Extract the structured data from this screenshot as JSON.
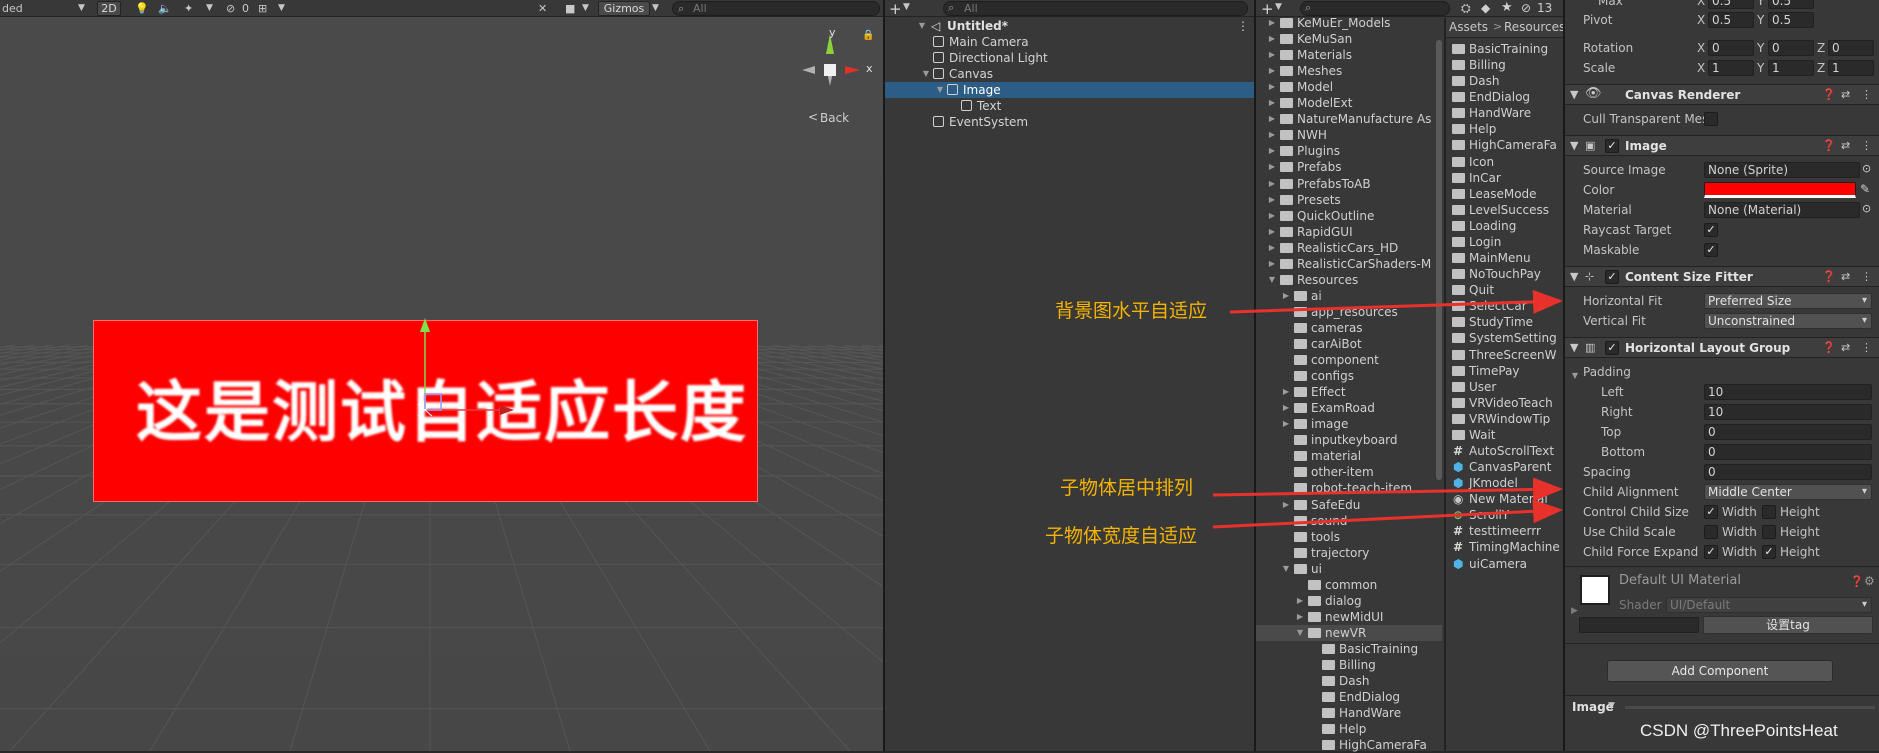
{
  "scene": {
    "toolbar": {
      "shading_mode": "ded",
      "mode_2d": "2D",
      "hidden_count": "0",
      "gizmos": "Gizmos",
      "search_placeholder": "All"
    },
    "gizmo": {
      "y": "y",
      "x": "x",
      "back": "Back"
    },
    "canvas_text": "这是测试自适应长度"
  },
  "hierarchy": {
    "search_placeholder": "All",
    "scene_name": "Untitled*",
    "items": [
      {
        "label": "Main Camera",
        "level": 1
      },
      {
        "label": "Directional Light",
        "level": 1
      },
      {
        "label": "Canvas",
        "level": 1
      },
      {
        "label": "Image",
        "level": 2
      },
      {
        "label": "Text",
        "level": 3
      },
      {
        "label": "EventSystem",
        "level": 1
      }
    ]
  },
  "project": {
    "search_placeholder": "",
    "hidden_count": "13",
    "folders": [
      {
        "label": "KeMuEr_Models",
        "level": 0,
        "arrow": "right"
      },
      {
        "label": "KeMuSan",
        "level": 0,
        "arrow": "right"
      },
      {
        "label": "Materials",
        "level": 0,
        "arrow": "right"
      },
      {
        "label": "Meshes",
        "level": 0,
        "arrow": "right"
      },
      {
        "label": "Model",
        "level": 0,
        "arrow": "right"
      },
      {
        "label": "ModelExt",
        "level": 0,
        "arrow": "right"
      },
      {
        "label": "NatureManufacture As",
        "level": 0,
        "arrow": "right"
      },
      {
        "label": "NWH",
        "level": 0,
        "arrow": "right"
      },
      {
        "label": "Plugins",
        "level": 0,
        "arrow": "right"
      },
      {
        "label": "Prefabs",
        "level": 0,
        "arrow": "right"
      },
      {
        "label": "PrefabsToAB",
        "level": 0,
        "arrow": "right"
      },
      {
        "label": "Presets",
        "level": 0,
        "arrow": "right"
      },
      {
        "label": "QuickOutline",
        "level": 0,
        "arrow": "right"
      },
      {
        "label": "RapidGUI",
        "level": 0,
        "arrow": "right"
      },
      {
        "label": "RealisticCars_HD",
        "level": 0,
        "arrow": "right"
      },
      {
        "label": "RealisticCarShaders-M",
        "level": 0,
        "arrow": "right"
      },
      {
        "label": "Resources",
        "level": 0,
        "arrow": "down"
      },
      {
        "label": "ai",
        "level": 1,
        "arrow": "right"
      },
      {
        "label": "app_resources",
        "level": 1,
        "arrow": ""
      },
      {
        "label": "cameras",
        "level": 1,
        "arrow": ""
      },
      {
        "label": "carAiBot",
        "level": 1,
        "arrow": ""
      },
      {
        "label": "component",
        "level": 1,
        "arrow": ""
      },
      {
        "label": "configs",
        "level": 1,
        "arrow": ""
      },
      {
        "label": "Effect",
        "level": 1,
        "arrow": "right"
      },
      {
        "label": "ExamRoad",
        "level": 1,
        "arrow": "right"
      },
      {
        "label": "image",
        "level": 1,
        "arrow": "right"
      },
      {
        "label": "inputkeyboard",
        "level": 1,
        "arrow": ""
      },
      {
        "label": "material",
        "level": 1,
        "arrow": ""
      },
      {
        "label": "other-item",
        "level": 1,
        "arrow": ""
      },
      {
        "label": "robot-teach-item",
        "level": 1,
        "arrow": ""
      },
      {
        "label": "SafeEdu",
        "level": 1,
        "arrow": "right"
      },
      {
        "label": "sound",
        "level": 1,
        "arrow": ""
      },
      {
        "label": "tools",
        "level": 1,
        "arrow": ""
      },
      {
        "label": "trajectory",
        "level": 1,
        "arrow": ""
      },
      {
        "label": "ui",
        "level": 1,
        "arrow": "down"
      },
      {
        "label": "common",
        "level": 2,
        "arrow": ""
      },
      {
        "label": "dialog",
        "level": 2,
        "arrow": "right"
      },
      {
        "label": "newMidUI",
        "level": 2,
        "arrow": "right"
      },
      {
        "label": "newVR",
        "level": 2,
        "arrow": "down"
      },
      {
        "label": "BasicTraining",
        "level": 3,
        "arrow": ""
      },
      {
        "label": "Billing",
        "level": 3,
        "arrow": ""
      },
      {
        "label": "Dash",
        "level": 3,
        "arrow": ""
      },
      {
        "label": "EndDialog",
        "level": 3,
        "arrow": ""
      },
      {
        "label": "HandWare",
        "level": 3,
        "arrow": ""
      },
      {
        "label": "Help",
        "level": 3,
        "arrow": ""
      },
      {
        "label": "HighCameraFa",
        "level": 3,
        "arrow": ""
      }
    ],
    "breadcrumb": [
      "Assets",
      "Resources"
    ],
    "files": [
      {
        "label": "BasicTraining",
        "kind": "folder"
      },
      {
        "label": "Billing",
        "kind": "folder"
      },
      {
        "label": "Dash",
        "kind": "folder"
      },
      {
        "label": "EndDialog",
        "kind": "folder"
      },
      {
        "label": "HandWare",
        "kind": "folder"
      },
      {
        "label": "Help",
        "kind": "folder"
      },
      {
        "label": "HighCameraFa",
        "kind": "folder"
      },
      {
        "label": "Icon",
        "kind": "folder"
      },
      {
        "label": "InCar",
        "kind": "folder"
      },
      {
        "label": "LeaseMode",
        "kind": "folder"
      },
      {
        "label": "LevelSuccess",
        "kind": "folder"
      },
      {
        "label": "Loading",
        "kind": "folder"
      },
      {
        "label": "Login",
        "kind": "folder"
      },
      {
        "label": "MainMenu",
        "kind": "folder"
      },
      {
        "label": "NoTouchPay",
        "kind": "folder"
      },
      {
        "label": "Quit",
        "kind": "folder"
      },
      {
        "label": "SelectCar",
        "kind": "folder"
      },
      {
        "label": "StudyTime",
        "kind": "folder"
      },
      {
        "label": "SystemSetting",
        "kind": "folder"
      },
      {
        "label": "ThreeScreenW",
        "kind": "folder"
      },
      {
        "label": "TimePay",
        "kind": "folder"
      },
      {
        "label": "User",
        "kind": "folder"
      },
      {
        "label": "VRVideoTeach",
        "kind": "folder"
      },
      {
        "label": "VRWindowTip",
        "kind": "folder"
      },
      {
        "label": "Wait",
        "kind": "folder"
      },
      {
        "label": "AutoScrollText",
        "kind": "script"
      },
      {
        "label": "CanvasParent",
        "kind": "prefab"
      },
      {
        "label": "JKmodel",
        "kind": "prefab"
      },
      {
        "label": "New Material",
        "kind": "material"
      },
      {
        "label": "ScrollY",
        "kind": "asset"
      },
      {
        "label": "testtimeerrr",
        "kind": "script"
      },
      {
        "label": "TimingMachine",
        "kind": "script"
      },
      {
        "label": "uiCamera",
        "kind": "prefab"
      }
    ]
  },
  "inspector": {
    "top": {
      "max_label": "Max",
      "max_x": "0.5",
      "max_y": "0.5",
      "pivot_label": "Pivot",
      "pivot_x": "0.5",
      "pivot_y": "0.5",
      "rotation_label": "Rotation",
      "rot_x": "0",
      "rot_y": "0",
      "rot_z": "0",
      "scale_label": "Scale",
      "scale_x": "1",
      "scale_y": "1",
      "scale_z": "1",
      "x": "X",
      "y": "Y",
      "z": "Z"
    },
    "canvas_renderer": {
      "title": "Canvas Renderer",
      "cull_label": "Cull Transparent Mes"
    },
    "image": {
      "title": "Image",
      "source_label": "Source Image",
      "source_value": "None (Sprite)",
      "color_label": "Color",
      "color_value": "#ff0000",
      "material_label": "Material",
      "material_value": "None (Material)",
      "raycast_label": "Raycast Target",
      "maskable_label": "Maskable"
    },
    "csf": {
      "title": "Content Size Fitter",
      "h_label": "Horizontal Fit",
      "h_value": "Preferred Size",
      "v_label": "Vertical Fit",
      "v_value": "Unconstrained"
    },
    "hlg": {
      "title": "Horizontal Layout Group",
      "padding_label": "Padding",
      "left_label": "Left",
      "left": "10",
      "right_label": "Right",
      "right": "10",
      "top_label": "Top",
      "top": "0",
      "bottom_label": "Bottom",
      "bottom": "0",
      "spacing_label": "Spacing",
      "spacing": "0",
      "align_label": "Child Alignment",
      "align_value": "Middle Center",
      "ccs_label": "Control Child Size",
      "ucs_label": "Use Child Scale",
      "cfe_label": "Child Force Expand",
      "width": "Width",
      "height": "Height"
    },
    "material": {
      "title": "Default UI Material",
      "shader_label": "Shader",
      "shader_value": "UI/Default",
      "tag_button": "设置tag"
    },
    "add_component": "Add Component",
    "footer": "Image"
  },
  "annotations": {
    "bg_fit": "背景图水平自适应",
    "center": "子物体居中排列",
    "width_fit": "子物体宽度自适应"
  },
  "watermark": "CSDN @ThreePointsHeat",
  "colors": {
    "accent_select": "#2c5d87",
    "image_color": "#ff0000",
    "annotation": "#f5b400"
  }
}
